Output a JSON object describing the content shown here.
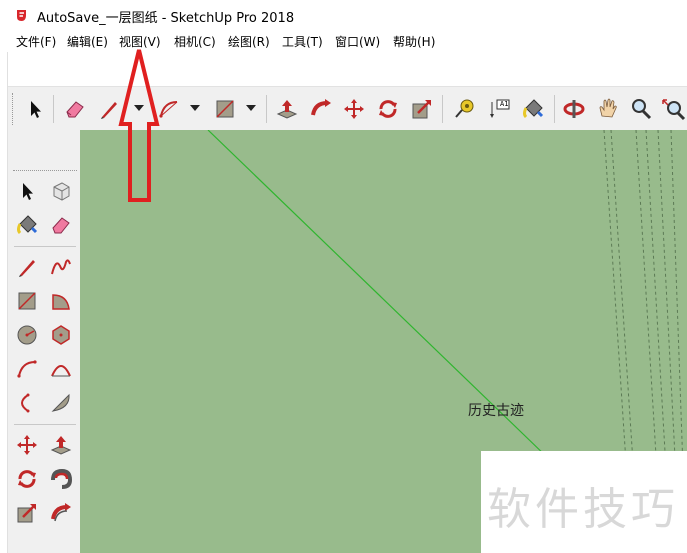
{
  "window": {
    "title": "AutoSave_一层图纸 - SketchUp Pro 2018",
    "logo_icon": "sketchup-logo-icon"
  },
  "menu": [
    {
      "label": "文件(F)"
    },
    {
      "label": "编辑(E)"
    },
    {
      "label": "视图(V)"
    },
    {
      "label": "相机(C)"
    },
    {
      "label": "绘图(R)"
    },
    {
      "label": "工具(T)"
    },
    {
      "label": "窗口(W)"
    },
    {
      "label": "帮助(H)"
    }
  ],
  "toolbar_top": [
    "select-arrow-icon",
    "eraser-icon",
    "pencil-line-icon",
    "arc-icon",
    "rectangle-icon",
    "push-pull-icon",
    "follow-me-icon",
    "move-icon",
    "rotate-icon",
    "offset-icon",
    "tape-measure-icon",
    "text-label-icon",
    "paint-bucket-icon",
    "orbit-icon",
    "pan-hand-icon",
    "zoom-icon",
    "zoom-extents-icon"
  ],
  "text_tool_glyph": "A1",
  "left_toolbar": [
    "select-arrow-icon",
    "make-component-icon",
    "paint-bucket-icon",
    "eraser-icon",
    "line-icon",
    "freehand-icon",
    "rectangle-icon",
    "rotated-rectangle-icon",
    "circle-icon",
    "polygon-icon",
    "arc-icon",
    "two-point-arc-icon",
    "three-point-arc-icon",
    "pie-icon",
    "move-icon",
    "push-pull-icon",
    "rotate-icon",
    "follow-me-icon",
    "scale-icon",
    "offset-icon"
  ],
  "canvas": {
    "background_color": "#98bb8c",
    "edge_color": "#2fb52f",
    "label": "历史古迹"
  },
  "annotation": {
    "arrow_color": "#e02020",
    "target": "视图(V)"
  },
  "watermark": {
    "text": "软件技巧"
  }
}
